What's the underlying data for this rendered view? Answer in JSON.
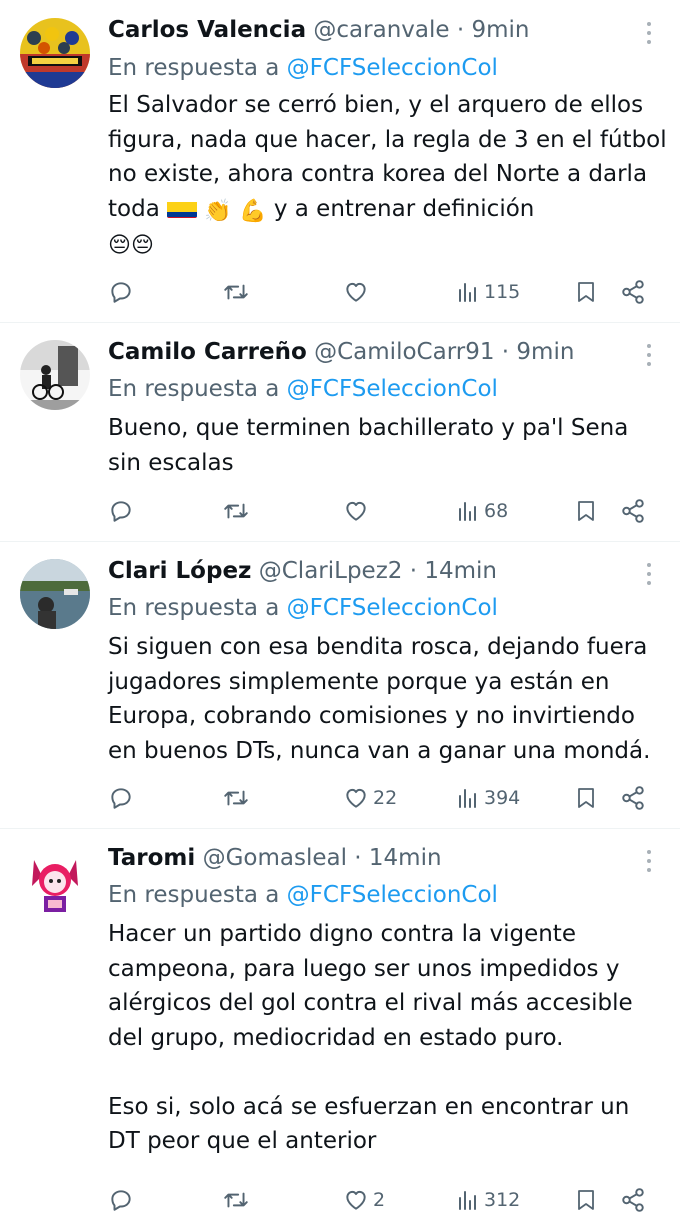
{
  "tweets": [
    {
      "name": "Carlos Valencia",
      "handle": "@caranvale",
      "time": "· 9min",
      "reply_prefix": "En respuesta a",
      "reply_to": "@FCFSeleccionCol",
      "text_main": "El Salvador se cerró bien, y el arquero de ellos figura, nada que hacer, la regla de 3 en el fútbol no existe, ahora contra korea del Norte a darla toda",
      "text_tail": "y a entrenar definición",
      "emojis": [
        "colombia-flag",
        "clapping-hands",
        "flexed-biceps",
        "pensive-face",
        "pensive-face"
      ],
      "stats": {
        "replies": "",
        "retweets": "",
        "likes": "",
        "views": "115"
      }
    },
    {
      "name": "Camilo Carreño",
      "handle": "@CamiloCarr91",
      "time": "· 9min",
      "reply_prefix": "En respuesta a",
      "reply_to": "@FCFSeleccionCol",
      "text": "Bueno, que terminen bachillerato y pa'l Sena sin escalas",
      "stats": {
        "replies": "",
        "retweets": "",
        "likes": "",
        "views": "68"
      }
    },
    {
      "name": "Clari López",
      "handle": "@ClariLpez2",
      "time": "· 14min",
      "reply_prefix": "En respuesta a",
      "reply_to": "@FCFSeleccionCol",
      "text": "Si siguen con esa bendita rosca, dejando fuera jugadores simplemente porque ya están en Europa, cobrando comisiones y no invirtiendo en buenos DTs, nunca van a ganar una mondá.",
      "stats": {
        "replies": "",
        "retweets": "",
        "likes": "22",
        "views": "394"
      }
    },
    {
      "name": "Taromi",
      "handle": "@Gomasleal",
      "time": "· 14min",
      "reply_prefix": "En respuesta a",
      "reply_to": "@FCFSeleccionCol",
      "text": "Hacer un partido digno contra la vigente campeona, para luego ser unos impedidos y alérgicos del gol contra el rival más accesible del grupo, mediocridad en estado puro.\n\nEso si, solo acá se esfuerzan en encontrar un DT peor que el anterior",
      "stats": {
        "replies": "",
        "retweets": "",
        "likes": "2",
        "views": "312"
      }
    }
  ],
  "icons": [
    "reply-icon",
    "retweet-icon",
    "like-icon",
    "views-icon",
    "bookmark-icon",
    "share-icon",
    "more-icon"
  ],
  "colors": {
    "text": "#0f1419",
    "secondary": "#536471",
    "mention": "#1d9bf0",
    "divider": "#eff3f4"
  }
}
